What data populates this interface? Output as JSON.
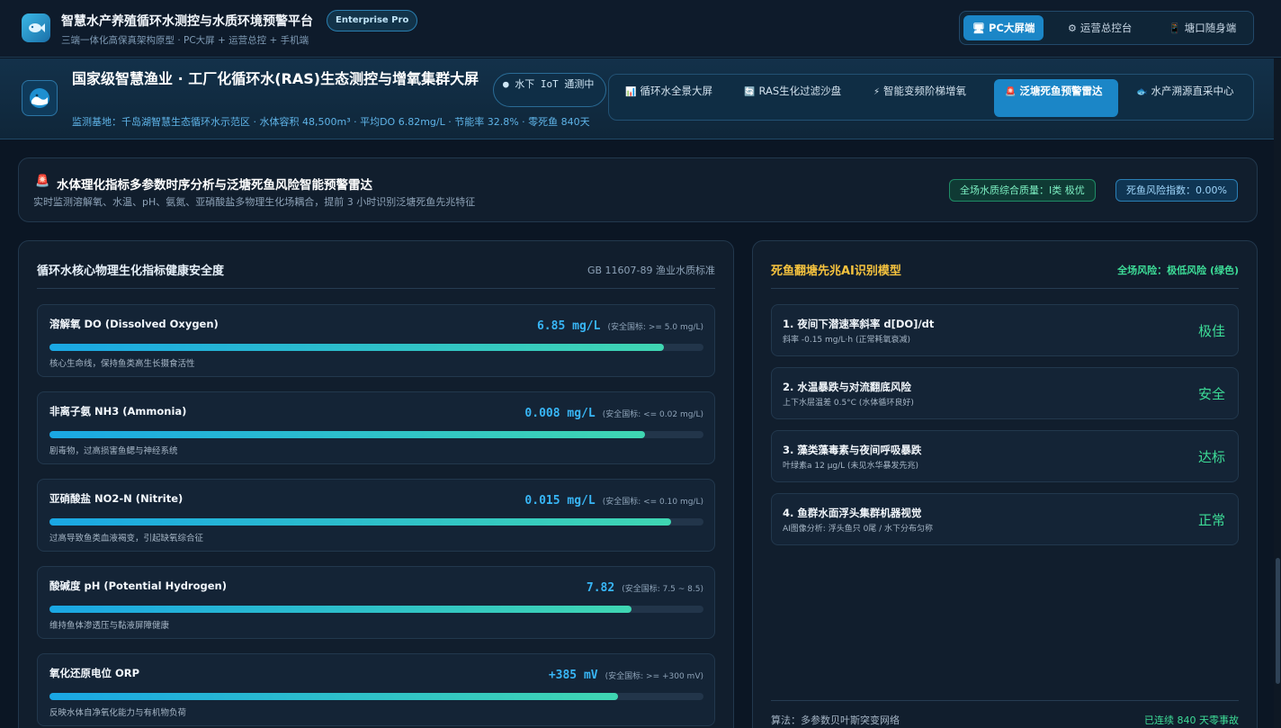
{
  "app": {
    "title": "智慧水产养殖循环水测控与水质环境预警平台",
    "edition": "Enterprise Pro",
    "subtitle": "三端一体化高保真架构原型 · PC大屏 + 运营总控 + 手机端",
    "modes": [
      {
        "icon": "monitor",
        "label": "PC大屏端",
        "active": true
      },
      {
        "icon": "gear",
        "label": "运营总控台",
        "active": false
      },
      {
        "icon": "phone",
        "label": "塘口随身端",
        "active": false
      }
    ]
  },
  "module": {
    "title": "国家级智慧渔业 · 工厂化循环水(RAS)生态测控与增氧集群大屏",
    "iot_badge": "● 水下 IoT 通测中",
    "meta": "监测基地：千岛湖智慧生态循环水示范区 · 水体容积 48,500m³ · 平均DO 6.82mg/L · 节能率 32.8% · 零死鱼 840天",
    "tabs": [
      {
        "icon": "chart",
        "label": "循环水全景大屏",
        "active": false
      },
      {
        "icon": "recycle",
        "label": "RAS生化过滤沙盘",
        "active": false
      },
      {
        "icon": "bolt",
        "label": "智能变频阶梯增氧",
        "active": false
      },
      {
        "icon": "siren",
        "label": "泛塘死鱼预警雷达",
        "active": true
      },
      {
        "icon": "fish",
        "label": "水产溯源直采中心",
        "active": false
      }
    ]
  },
  "banner": {
    "title": "水体理化指标多参数时序分析与泛塘死鱼风险智能预警雷达",
    "subtitle": "实时监测溶解氧、水温、pH、氨氮、亚硝酸盐多物理生化场耦合，提前 3 小时识别泛塘死鱼先兆特征",
    "quality": "全场水质综合质量：I类 极优",
    "risk_index": "死鱼风险指数：0.00%"
  },
  "metrics_panel": {
    "title": "循环水核心物理生化指标健康安全度",
    "standard": "GB 11607-89 渔业水质标准",
    "items": [
      {
        "name": "溶解氧 DO (Dissolved Oxygen)",
        "value": "6.85 mg/L",
        "standard": "(安全国标: >= 5.0 mg/L)",
        "desc": "核心生命线，保持鱼类高生长摄食活性",
        "level": 0.94
      },
      {
        "name": "非离子氨 NH3 (Ammonia)",
        "value": "0.008 mg/L",
        "standard": "(安全国标: <= 0.02 mg/L)",
        "desc": "剧毒物，过高损害鱼鳃与神经系统",
        "level": 0.91
      },
      {
        "name": "亚硝酸盐 NO2-N (Nitrite)",
        "value": "0.015 mg/L",
        "standard": "(安全国标: <= 0.10 mg/L)",
        "desc": "过高导致鱼类血液褐变，引起缺氧综合征",
        "level": 0.95
      },
      {
        "name": "酸碱度 pH (Potential Hydrogen)",
        "value": "7.82",
        "standard": "(安全国标: 7.5 ~ 8.5)",
        "desc": "维持鱼体渗透压与黏液屏障健康",
        "level": 0.89
      },
      {
        "name": "氧化还原电位 ORP",
        "value": "+385 mV",
        "standard": "(安全国标: >= +300 mV)",
        "desc": "反映水体自净氧化能力与有机物负荷",
        "level": 0.87
      }
    ]
  },
  "ai_panel": {
    "title": "死鱼翻塘先兆AI识别模型",
    "overall_risk": "全场风险：极低风险 (绿色)",
    "cards": [
      {
        "title": "1. 夜间下潜速率斜率 d[DO]/dt",
        "desc": "斜率 -0.15 mg/L·h (正常耗氧衰减)",
        "status": "极佳"
      },
      {
        "title": "2. 水温暴跌与对流翻底风险",
        "desc": "上下水层温差 0.5°C (水体循环良好)",
        "status": "安全"
      },
      {
        "title": "3. 藻类藻毒素与夜间呼吸暴跌",
        "desc": "叶绿素a 12 μg/L (未见水华暴发先兆)",
        "status": "达标"
      },
      {
        "title": "4. 鱼群水面浮头集群机器视觉",
        "desc": "AI图像分析: 浮头鱼只 0尾 / 水下分布匀称",
        "status": "正常"
      }
    ],
    "algorithm": "算法：多参数贝叶斯突变网络",
    "record": "已连续 840 天零事故"
  },
  "colors": {
    "accent": "#1b86c7",
    "value_blue": "#38b6f6",
    "safe_green": "#3ddc97",
    "warn_gold": "#f6c33e"
  }
}
